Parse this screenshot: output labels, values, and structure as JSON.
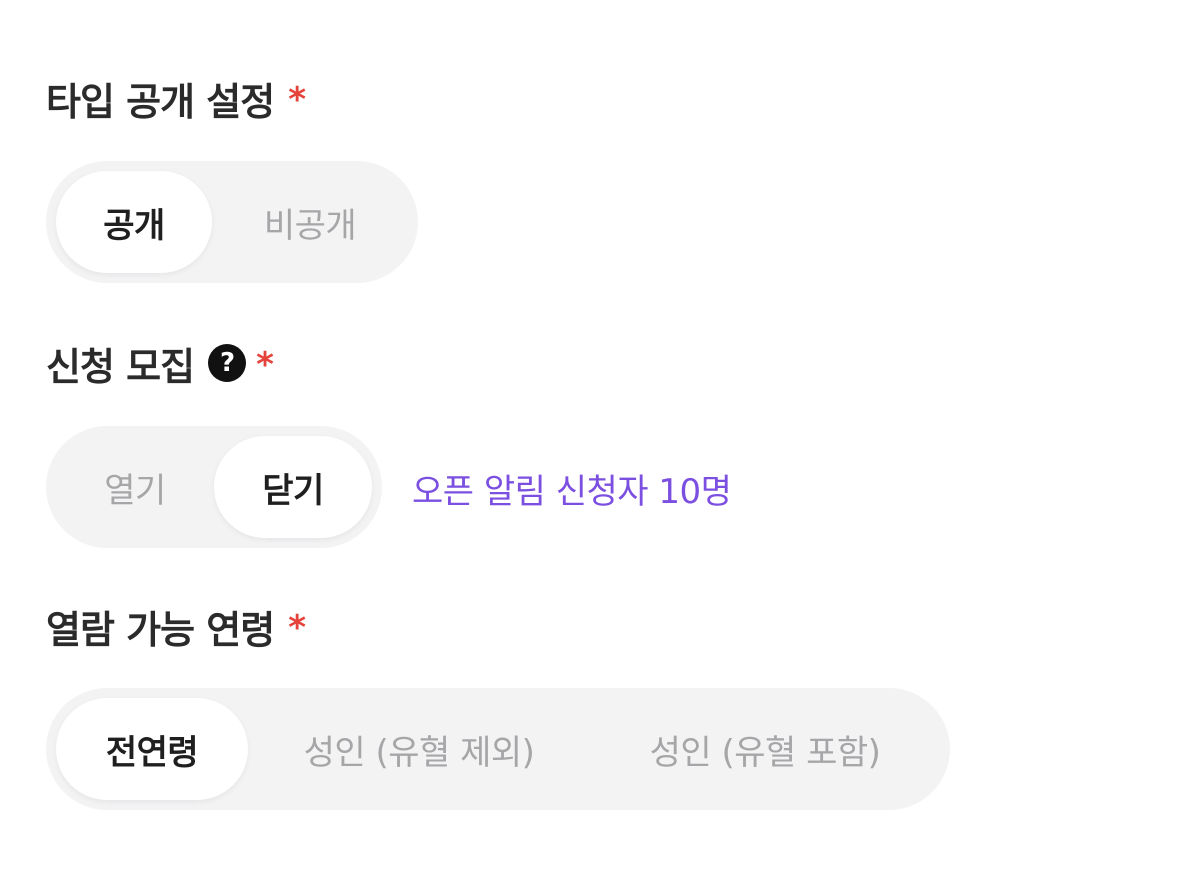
{
  "sections": {
    "visibility": {
      "title": "타입 공개 설정",
      "required_mark": "*",
      "options": [
        "공개",
        "비공개"
      ],
      "selected": "공개"
    },
    "recruit": {
      "title": "신청 모집",
      "help_icon_glyph": "?",
      "required_mark": "*",
      "options": [
        "열기",
        "닫기"
      ],
      "selected": "닫기",
      "notify_text": "오픈 알림 신청자 10명"
    },
    "age": {
      "title": "열람 가능 연령",
      "required_mark": "*",
      "options": [
        "전연령",
        "성인 (유혈 제외)",
        "성인 (유혈 포함)"
      ],
      "selected": "전연령"
    }
  },
  "colors": {
    "required": "#e5423b",
    "accent_link": "#7b4fe0",
    "segment_track": "#f3f3f4",
    "segment_active": "#ffffff",
    "text_active": "#1f1f1f",
    "text_inactive": "#a6a6a8"
  },
  "icons": {
    "help": "question-circle-icon"
  }
}
